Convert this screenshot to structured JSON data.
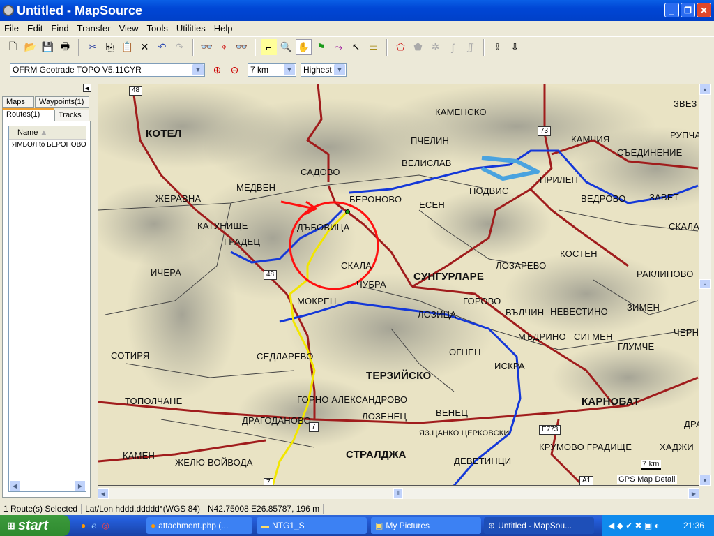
{
  "window": {
    "title": "Untitled - MapSource"
  },
  "menu": [
    "File",
    "Edit",
    "Find",
    "Transfer",
    "View",
    "Tools",
    "Utilities",
    "Help"
  ],
  "toolbar2": {
    "map_product": "OFRM Geotrade TOPO V5.11CYR",
    "zoom_level": "7 km",
    "detail": "Highest"
  },
  "left_panel": {
    "tabs": {
      "maps": "Maps",
      "waypoints": "Waypoints(1)",
      "routes": "Routes(1)",
      "tracks": "Tracks"
    },
    "column_name": "Name",
    "routes": [
      "ЯМБОЛ to БЕРОНОВО"
    ]
  },
  "map": {
    "towns": [
      "КОТЕЛ",
      "КАМЕНСКО",
      "ЗВЕЗ",
      "ПЧЕЛИН",
      "КАМЧИЯ",
      "РУПЧА",
      "ВЕЛИСЛАВ",
      "САДОВО",
      "СЪЕДИНЕНИЕ",
      "МЕДВЕН",
      "ПОДВИС",
      "ПРИЛЕП",
      "БЕРОНОВО",
      "ЖЕРАВНА",
      "ЕСЕН",
      "ВЕДРОВО",
      "ЗАВЕТ",
      "КАТУНИЩЕ",
      "ДЪБОВИЦА",
      "СКАЛА",
      "ГРАДЕЦ",
      "КОСТЕН",
      "СКАЛА",
      "ЛОЗАРЕВО",
      "ИЧЕРА",
      "СУНГУРЛАРЕ",
      "РАКЛИНОВО",
      "ЧУБРА",
      "МОКРЕН",
      "ГОРОВО",
      "ЛОЗИЦА",
      "ВЪЛЧИН",
      "НЕВЕСТИНО",
      "ЗИМЕН",
      "ЧЕРН",
      "МЪДРИНО",
      "СИГМЕН",
      "ГЛУМЧЕ",
      "СОТИРЯ",
      "СЕДЛАРЕВО",
      "ОГНЕН",
      "ИСКРА",
      "ТЕРЗИЙСКО",
      "ТОПОЛЧАНЕ",
      "ГОРНО АЛЕКСАНДРОВО",
      "КАРНОБАТ",
      "ДРАГОДАНОВО",
      "ЛОЗЕНЕЦ",
      "ВЕНЕЦ",
      "ДРА",
      "ЯЗ.ЦАНКО ЦЕРКОВСКИ",
      "КРУМОВО ГРАДИЩЕ",
      "ХАДЖИ",
      "КАМЕН",
      "ЖЕЛЮ ВОЙВОДА",
      "СТРАЛДЖА",
      "ДЕВЕТИНЦИ"
    ],
    "road_shields": [
      "48",
      "73",
      "48",
      "7",
      "E773",
      "7",
      "A1"
    ],
    "scale": "7 km",
    "detail_label": "GPS Map Detail",
    "colors": {
      "road": "#a01c1c",
      "river": "#1438d8",
      "route": "#f2e600",
      "annotation": "#ff1010"
    }
  },
  "status": {
    "selection": "1 Route(s) Selected",
    "format": "Lat/Lon hddd.ddddd°(WGS 84)",
    "position": "N42.75008 E26.85787, 196 m"
  },
  "taskbar": {
    "start": "start",
    "tasks": [
      "attachment.php (...",
      "NTG1_S",
      "My Pictures",
      "Untitled - MapSou..."
    ],
    "clock": "21:36"
  }
}
